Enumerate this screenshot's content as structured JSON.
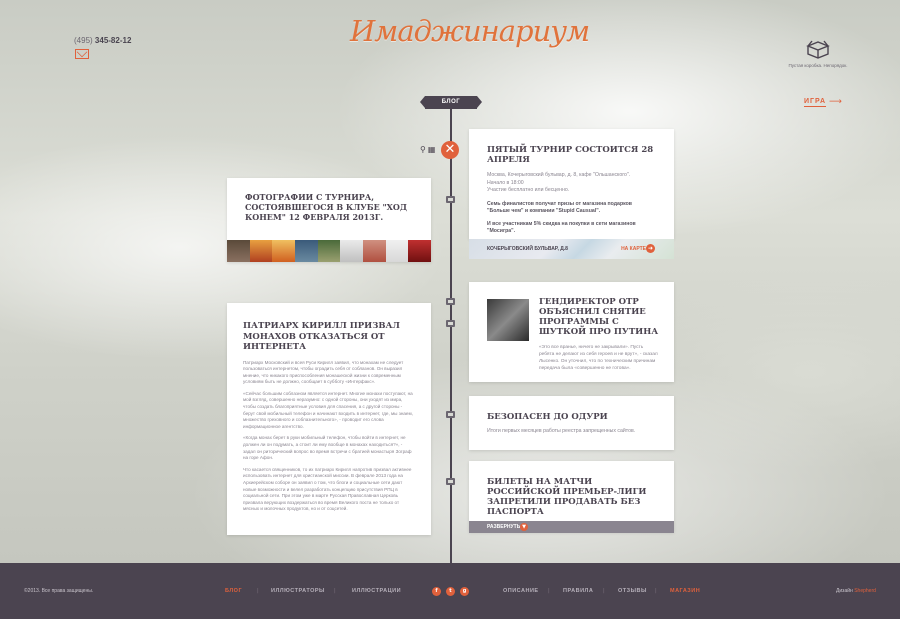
{
  "header": {
    "phone_code": "(495)",
    "phone_number": "345-82-12",
    "logo": "Имаджинариум",
    "box_caption": "Пустая коробка. Непорядок.",
    "game_link": "ИГРА"
  },
  "timeline": {
    "label": "БЛОГ"
  },
  "cards": {
    "tournament": {
      "title": "ПЯТЫЙ ТУРНИР СОСТОИТСЯ 28 АПРЕЛЯ",
      "line1": "Москва, Кочерыговский бульвар, д. 8, кафе \"Ольшанского\".",
      "line2": "Начало в 18:00",
      "line3": "Участие бесплатно или бесценно.",
      "prize1": "Семь финалистов получат призы от магазина подарков \"Больше чем\" и компании \"Stupid Causual\".",
      "prize2": "И все участникам 5% скидка на покупки в сети магазинов \"Мосигра\".",
      "map_address": "КОЧЕРЫГОВСКИЙ БУЛЬВАР, Д.8",
      "map_link": "НА КАРТЕ"
    },
    "photos": {
      "title": "ФОТОГРАФИИ С ТУРНИРА, СОСТОЯВШЕГОСЯ В КЛУБЕ \"ХОД КОНЕМ\" 12 ФЕВРАЛЯ 2013Г."
    },
    "director": {
      "title": "ГЕНДИРЕКТОР ОТР ОБЪЯСНИЛ СНЯТИЕ ПРОГРАММЫ С ШУТКОЙ ПРО ПУТИНА",
      "text": "«Это все вранье, ничего не закрывали». Пусть ребята не делают из себя героев и не врут», - сказал Лысенко. Он уточнил, что по техническим причинам передача была «совершенно не готова»."
    },
    "patriarch": {
      "title": "ПАТРИАРХ КИРИЛЛ ПРИЗВАЛ МОНАХОВ ОТКАЗАТЬСЯ ОТ ИНТЕРНЕТА",
      "p1": "Патриарх Московский и всея Руси Кирилл заявил, что монахам не следует пользоваться интернетом, чтобы оградить себя от соблазнов. Он выразил мнение, что никакого приспособления монашеской жизни к современным условиям быть не должно, сообщает в субботу «Интерфакс».",
      "p2": "«Сейчас большим соблазном является интернет. Многие монахи поступают, на мой взгляд, совершенно неразумно: с одной стороны, они уходят из мира, чтобы создать благоприятные условия для спасения, а с другой стороны - берут свой мобильный телефон и начинают входить в интернет, где, мы знаем, множество греховного и соблазнительного», - проводит его слова информационное агентство.",
      "p3": "«Когда монах берет в руки мобильный телефон, чтобы войти в интернет, не должен ли он подумать, а стоит ли ему вообще в монахах находиться?», - задал он риторический вопрос во время встречи с братией монастыря Зограф на горе Афон.",
      "p4": "Что касается священников, то их патриарх Кирилл напротив призвал активнее использовать интернет для христианской миссии. В феврале 2013 года на Архиерейском соборе он заявил о том, что блоги и социальные сети дают новые возможности и велел разработать концепцию присутствия РПЦ в социальной сети. При этом уже в марте Русская Православная Церковь призвала верующих воздержаться во время Великого поста не только от мясных и молочных продуктов, но и от соцсетей."
    },
    "safe": {
      "title": "БЕЗОПАСЕН ДО ОДУРИ",
      "text": "Итоги первых месяцев работы реестра запрещенных сайтов."
    },
    "tickets": {
      "title": "БИЛЕТЫ НА МАТЧИ РОССИЙСКОЙ ПРЕМЬЕР-ЛИГИ ЗАПРЕТИЛИ ПРОДАВАТЬ БЕЗ ПАСПОРТА",
      "expand": "РАЗВЕРНУТЬ"
    }
  },
  "footer": {
    "copyright": "©2013. Все права защищены.",
    "nav_left": [
      "БЛОГ",
      "ИЛЛЮСТРАТОРЫ",
      "ИЛЛЮСТРАЦИИ"
    ],
    "nav_right": [
      "ОПИСАНИЕ",
      "ПРАВИЛА",
      "ОТЗЫВЫ",
      "МАГАЗИН"
    ],
    "social": [
      "f",
      "t",
      "g"
    ],
    "design_prefix": "Дизайн",
    "design_author": "Shepherd"
  },
  "colors": {
    "accent": "#e0613c",
    "dark": "#4b4450"
  }
}
